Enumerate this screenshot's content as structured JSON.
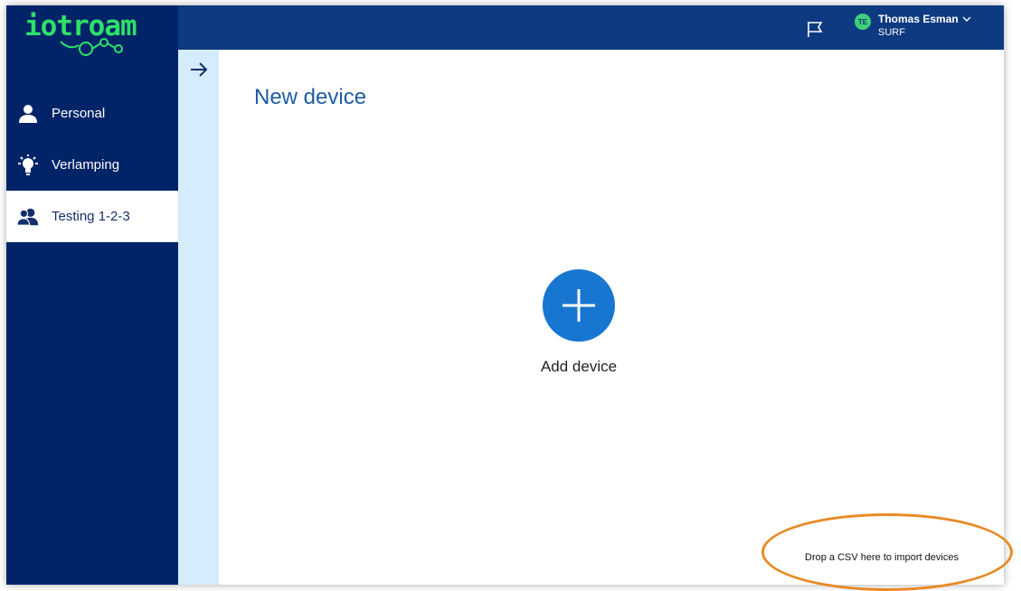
{
  "brand": {
    "logo_text": "iotroam",
    "logo_color": "#2ee06a"
  },
  "colors": {
    "sidebar": "#002467",
    "topbar": "#0d3a80",
    "rail": "#d4ecfb",
    "accent": "#1776cf",
    "highlight": "#e88a26"
  },
  "sidebar": {
    "items": [
      {
        "label": "Personal",
        "icon": "person-icon",
        "active": false
      },
      {
        "label": "Verlamping",
        "icon": "lightbulb-icon",
        "active": false
      },
      {
        "label": "Testing 1-2-3",
        "icon": "group-icon",
        "active": true
      }
    ]
  },
  "header": {
    "flag_icon": "flag-icon",
    "user": {
      "initials": "TE",
      "name": "Thomas Esman",
      "org": "SURF"
    }
  },
  "rail": {
    "toggle_icon": "arrow-right-icon"
  },
  "main": {
    "title": "New device",
    "add_label": "Add device",
    "drop_hint": "Drop a CSV here to import devices"
  }
}
